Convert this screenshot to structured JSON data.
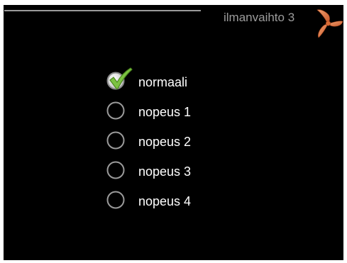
{
  "header": {
    "title": "ilmanvaihto 3",
    "icon": "fan-icon",
    "icon_color": "#e07a3a"
  },
  "options": [
    {
      "label": "normaali",
      "selected": true
    },
    {
      "label": "nopeus 1",
      "selected": false
    },
    {
      "label": "nopeus 2",
      "selected": false
    },
    {
      "label": "nopeus 3",
      "selected": false
    },
    {
      "label": "nopeus 4",
      "selected": false
    }
  ],
  "colors": {
    "background": "#000000",
    "title": "#9c9c9c",
    "text": "#ffffff",
    "check": "#7cc242"
  }
}
